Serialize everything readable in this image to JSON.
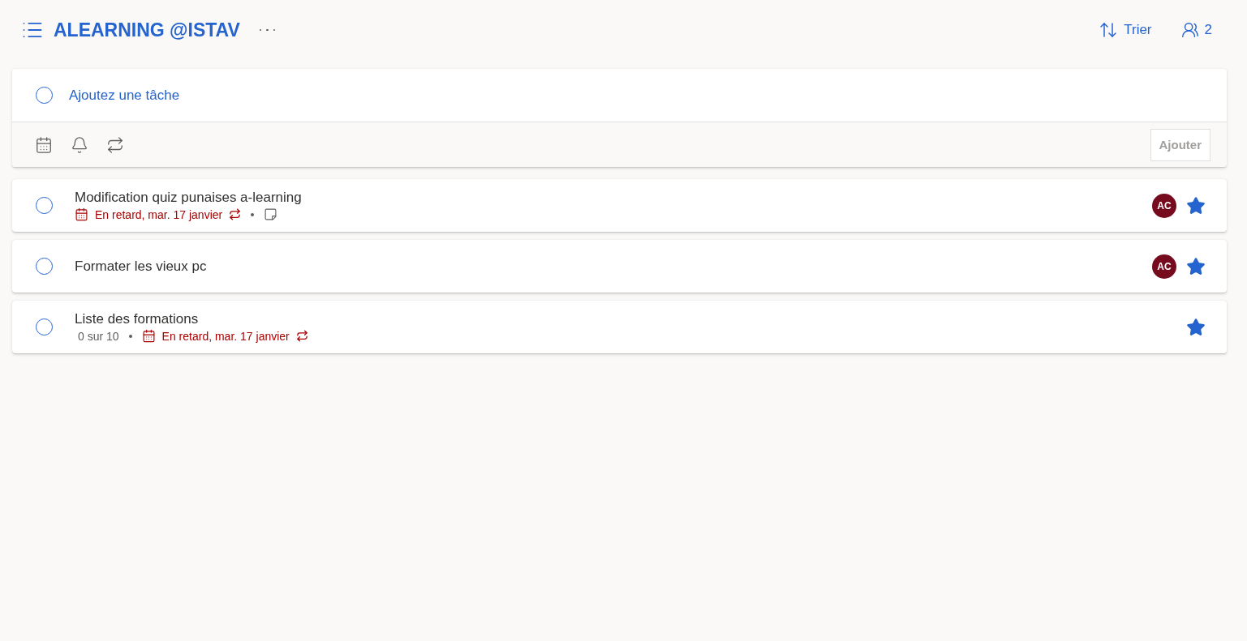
{
  "header": {
    "title": "ALEARNING @ISTAV",
    "sort_label": "Trier",
    "members_count": "2"
  },
  "add_task": {
    "placeholder": "Ajoutez une tâche",
    "button": {
      "label": "Ajouter",
      "disabled": true
    }
  },
  "tasks": [
    {
      "title": "Modification quiz punaises a-learning",
      "completed": false,
      "meta": [
        {
          "kind": "due",
          "text": "En retard, mar. 17 janvier",
          "overdue": true,
          "recurring": true
        },
        {
          "kind": "note"
        }
      ],
      "assignee": "AC",
      "important": true
    },
    {
      "title": "Formater les vieux pc",
      "completed": false,
      "assignee": "AC",
      "important": true
    },
    {
      "title": "Liste des formations",
      "completed": false,
      "meta": [
        {
          "kind": "progress",
          "text": "0 sur 10"
        },
        {
          "kind": "due",
          "text": "En retard, mar. 17 janvier",
          "overdue": true,
          "recurring": true
        }
      ],
      "important": true
    }
  ]
}
